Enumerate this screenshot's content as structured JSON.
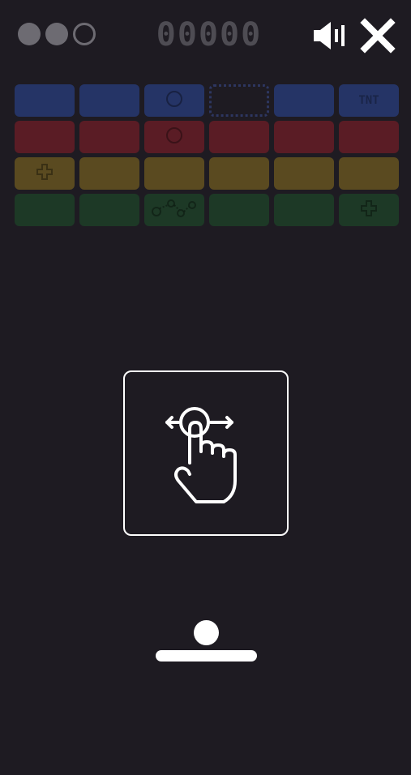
{
  "hud": {
    "lives_total": 3,
    "lives_remaining": 2,
    "score": "00000"
  },
  "icons": {
    "sound": "speaker-volume-icon",
    "close": "close-x-icon",
    "tutorial": "swipe-hand-icon"
  },
  "colors": {
    "background": "#1e1b22",
    "hud_gray": "#6d6b72",
    "score_gray": "#4e4c53",
    "blue": "#253466",
    "red": "#5a1c25",
    "yellow": "#5a4a20",
    "green": "#1d3926",
    "white": "#ffffff"
  },
  "bricks": [
    [
      {
        "color": "blue"
      },
      {
        "color": "blue"
      },
      {
        "color": "blue",
        "icon": "circle"
      },
      {
        "color": "empty"
      },
      {
        "color": "blue"
      },
      {
        "color": "blue",
        "label": "TNT"
      }
    ],
    [
      {
        "color": "red"
      },
      {
        "color": "red"
      },
      {
        "color": "red",
        "icon": "circle"
      },
      {
        "color": "red"
      },
      {
        "color": "red"
      },
      {
        "color": "red"
      }
    ],
    [
      {
        "color": "yellow",
        "icon": "plus"
      },
      {
        "color": "yellow"
      },
      {
        "color": "yellow"
      },
      {
        "color": "yellow"
      },
      {
        "color": "yellow"
      },
      {
        "color": "yellow"
      }
    ],
    [
      {
        "color": "green"
      },
      {
        "color": "green"
      },
      {
        "color": "green",
        "icon": "multiball"
      },
      {
        "color": "green"
      },
      {
        "color": "green"
      },
      {
        "color": "green",
        "icon": "plus"
      }
    ]
  ]
}
